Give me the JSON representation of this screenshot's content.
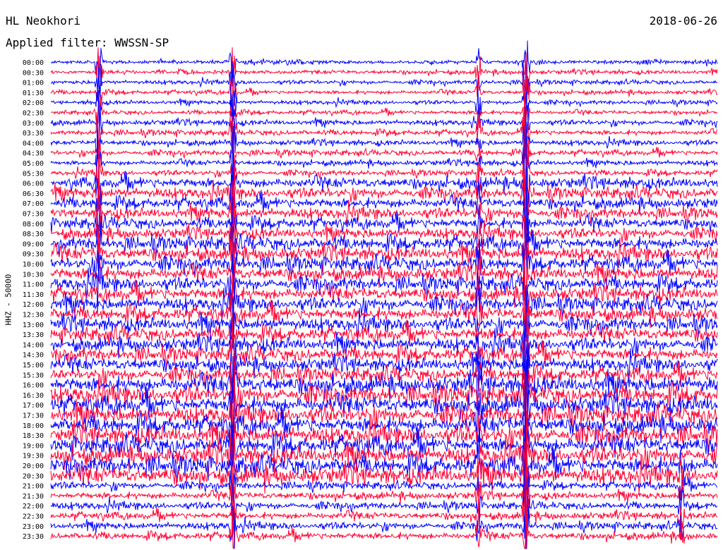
{
  "header": {
    "station": "HL Neokhori",
    "date": "2018-06-26",
    "filter": "Applied filter: WWSSN-SP"
  },
  "chart_data": {
    "type": "line",
    "title": "HL Neokhori",
    "subtitle": "Applied filter: WWSSN-SP",
    "ylabel": "HHZ - 50000",
    "xlabel": "",
    "row_labels": [
      "00:00",
      "00:30",
      "01:00",
      "01:30",
      "02:00",
      "02:30",
      "03:00",
      "03:30",
      "04:00",
      "04:30",
      "05:00",
      "05:30",
      "06:00",
      "06:30",
      "07:00",
      "07:30",
      "08:00",
      "08:30",
      "09:00",
      "09:30",
      "10:00",
      "10:30",
      "11:00",
      "11:30",
      "12:00",
      "12:30",
      "13:00",
      "13:30",
      "14:00",
      "14:30",
      "15:00",
      "15:30",
      "16:00",
      "16:30",
      "17:00",
      "17:30",
      "18:00",
      "18:30",
      "19:00",
      "19:30",
      "20:00",
      "20:30",
      "21:00",
      "21:30",
      "22:00",
      "22:30",
      "23:00",
      "23:30"
    ],
    "row_colors": [
      "#0000ff",
      "#ff0033"
    ],
    "row_duration_minutes": 30,
    "grid": false
  }
}
